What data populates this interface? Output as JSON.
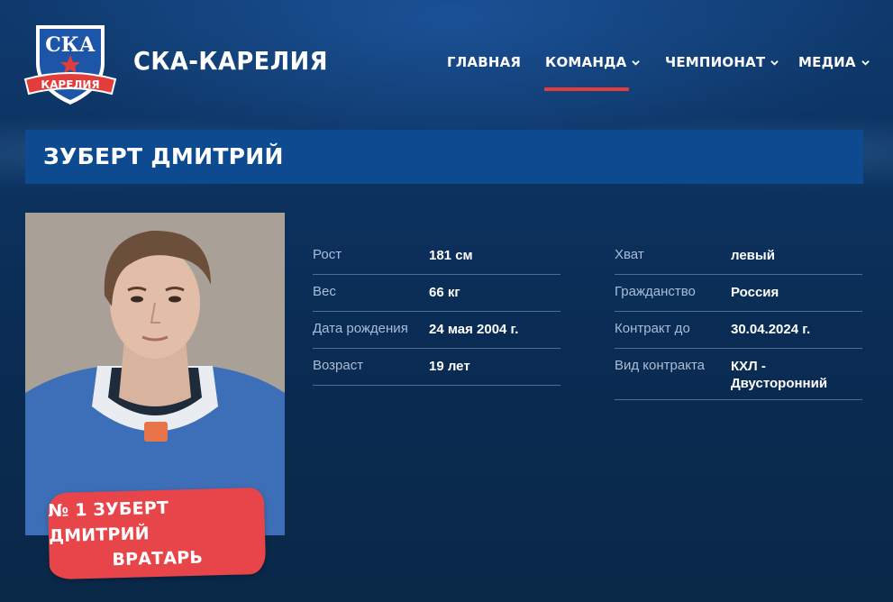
{
  "brand": {
    "name": "СКА-КАРЕЛИЯ",
    "logo_text_top": "СКА",
    "logo_text_bottom": "КАРЕЛИЯ",
    "colors": {
      "accent_red": "#e43b3b",
      "title_blue": "#0d4a8f",
      "background": "#0c325f"
    }
  },
  "nav": {
    "items": [
      {
        "label": "ГЛАВНАЯ",
        "dropdown": false,
        "active": false
      },
      {
        "label": "КОМАНДА",
        "dropdown": true,
        "active": true
      },
      {
        "label": "ЧЕМПИОНАТ",
        "dropdown": true,
        "active": false
      },
      {
        "label": "МЕДИА",
        "dropdown": true,
        "active": false
      }
    ]
  },
  "player": {
    "title": "ЗУБЕРТ ДМИТРИЙ",
    "badge_line1": "№ 1 ЗУБЕРТ ДМИТРИЙ",
    "badge_line2": "ВРАТАРЬ",
    "photo_icon": "player-photo"
  },
  "stats_left": [
    {
      "label": "Рост",
      "value": "181 см"
    },
    {
      "label": "Вес",
      "value": "66 кг"
    },
    {
      "label": "Дата рождения",
      "value": "24 мая 2004 г."
    },
    {
      "label": "Возраст",
      "value": "19 лет"
    }
  ],
  "stats_right": [
    {
      "label": "Хват",
      "value": "левый"
    },
    {
      "label": "Гражданство",
      "value": "Россия"
    },
    {
      "label": "Контракт до",
      "value": "30.04.2024 г."
    },
    {
      "label": "Вид контракта",
      "value": "КХЛ - Двусторонний"
    }
  ]
}
